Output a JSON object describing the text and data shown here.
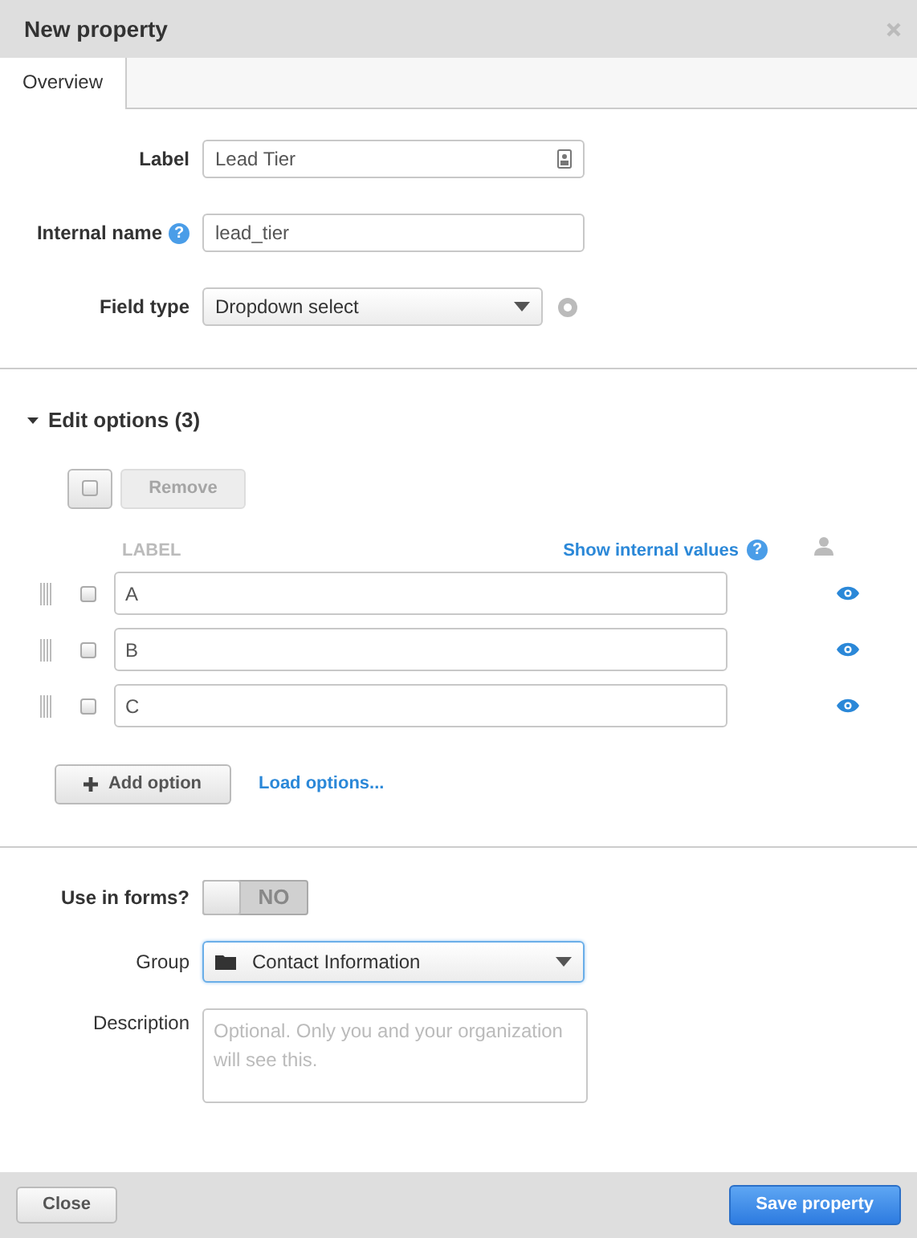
{
  "dialog": {
    "title": "New property"
  },
  "tabs": [
    {
      "label": "Overview",
      "selected": true
    }
  ],
  "fields": [
    {
      "kind": "text",
      "label": "Label",
      "value": "Lead Tier",
      "trailing_icon": true
    },
    {
      "kind": "text",
      "label": "Internal name",
      "value": "lead_tier",
      "help": "?"
    },
    {
      "kind": "select",
      "label": "Field type",
      "value": "Dropdown select"
    }
  ],
  "edit_options": {
    "title": "Edit options (3)",
    "expanded": true,
    "select_all": {
      "checked": false
    },
    "remove_button": {
      "label": "Remove",
      "disabled": true
    },
    "column_label": "LABEL",
    "show_internal_link": "Show internal values",
    "link_help": "?",
    "options": [
      {
        "value": "A",
        "checked": false,
        "visible": true
      },
      {
        "value": "B",
        "checked": false,
        "visible": true
      },
      {
        "value": "C",
        "checked": false,
        "visible": true
      }
    ],
    "add_button": "Add option",
    "load_link": "Load options..."
  },
  "use_in_forms": {
    "label": "Use in forms?",
    "on": false,
    "state_text": "NO"
  },
  "group": {
    "label": "Group",
    "value": "Contact Information"
  },
  "description": {
    "label": "Description",
    "placeholder": "Optional. Only you and your organization will see this."
  },
  "footer": {
    "close_button": "Close",
    "save_button": "Save property"
  }
}
